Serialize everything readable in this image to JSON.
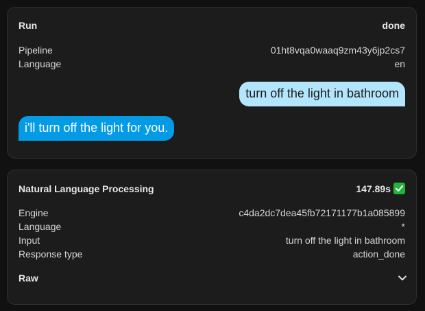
{
  "run": {
    "title": "Run",
    "status": "done",
    "rows": [
      {
        "label": "Pipeline",
        "value": "01ht8vqa0waaq9zm43y6jp2cs7"
      },
      {
        "label": "Language",
        "value": "en"
      }
    ],
    "user_message": "turn off the light in bathroom",
    "assistant_message": "i'll turn off the light for you."
  },
  "nlp": {
    "title": "Natural Language Processing",
    "duration": "147.89s",
    "status_icon": "check-icon",
    "rows": [
      {
        "label": "Engine",
        "value": "c4da2dc7dea45fb72171177b1a085899"
      },
      {
        "label": "Language",
        "value": "*"
      },
      {
        "label": "Input",
        "value": "turn off the light in bathroom"
      },
      {
        "label": "Response type",
        "value": "action_done"
      }
    ],
    "raw_label": "Raw",
    "raw_icon": "chevron-down-icon"
  },
  "colors": {
    "user_bubble": "#b3e5fc",
    "assistant_bubble": "#039be5",
    "success": "#1eb53a",
    "card_bg": "#1c1c1c"
  }
}
